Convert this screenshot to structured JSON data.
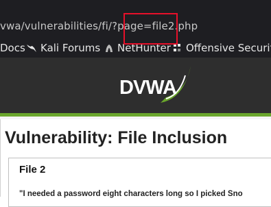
{
  "address_bar": {
    "url_text": "vwa/vulnerabilities/fi/?page=file2.php",
    "highlight_color": "#e8102a"
  },
  "bookmarks": {
    "items": [
      {
        "label": "Docs",
        "icon": "none"
      },
      {
        "label": "Kali Forums",
        "icon": "kali-dragon-icon"
      },
      {
        "label": "NetHunter",
        "icon": "nethunter-icon"
      },
      {
        "label": "Offensive Security",
        "icon": "offsec-icon"
      }
    ]
  },
  "header": {
    "logo_text": "DVWA",
    "accent_color": "#6aa62c"
  },
  "main": {
    "title": "Vulnerability: File Inclusion",
    "box": {
      "heading": "File 2",
      "quote": "\"I needed a password eight characters long so I picked Sno"
    }
  }
}
